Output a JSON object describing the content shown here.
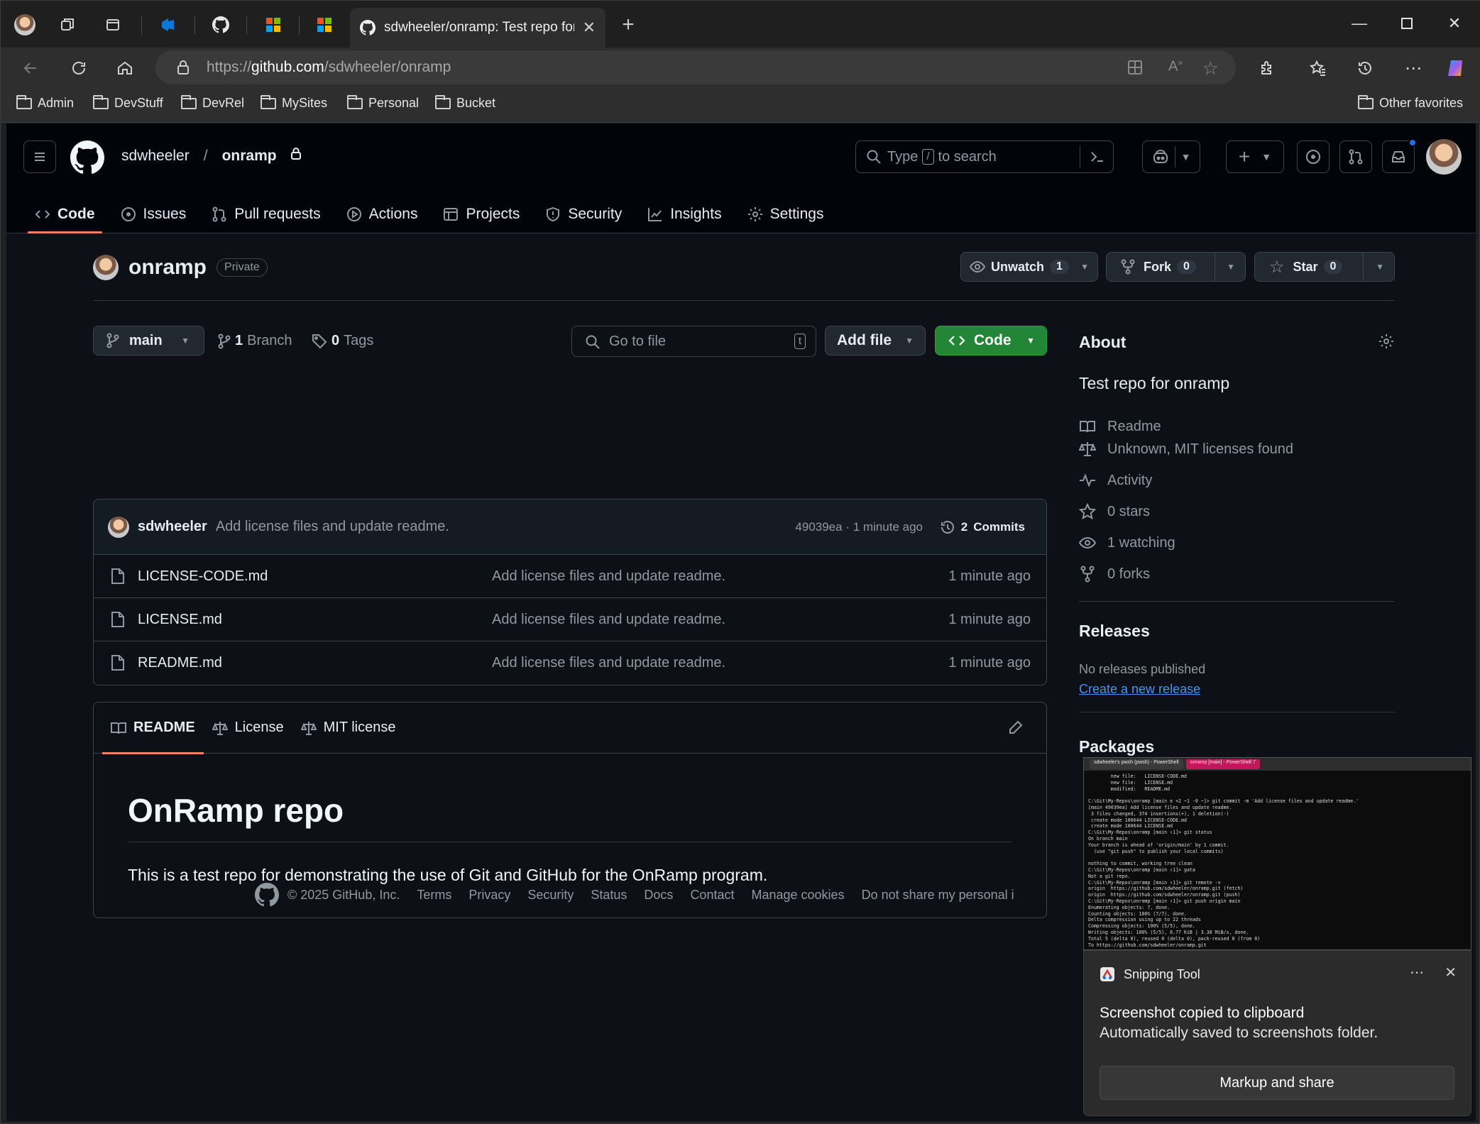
{
  "browser": {
    "active_tab_title": "sdwheeler/onramp: Test repo for onramp",
    "url_scheme": "https://",
    "url_host": "github.com",
    "url_path": "/sdwheeler/onramp",
    "favorites": [
      "Admin",
      "DevStuff",
      "DevRel",
      "MySites",
      "Personal",
      "Bucket"
    ],
    "other_favorites": "Other favorites"
  },
  "header": {
    "owner": "sdwheeler",
    "separator": "/",
    "repo": "onramp",
    "search_prefix": "Type",
    "search_key": "/",
    "search_suffix": "to search"
  },
  "repo_nav": [
    "Code",
    "Issues",
    "Pull requests",
    "Actions",
    "Projects",
    "Security",
    "Insights",
    "Settings"
  ],
  "repo": {
    "name": "onramp",
    "visibility": "Private",
    "unwatch_label": "Unwatch",
    "watch_count": "1",
    "fork_label": "Fork",
    "fork_count": "0",
    "star_label": "Star",
    "star_count": "0"
  },
  "toolbar": {
    "branch": "main",
    "branches_count": "1",
    "branches_label": "Branch",
    "tags_count": "0",
    "tags_label": "Tags",
    "goto_placeholder": "Go to file",
    "goto_key": "t",
    "add_file": "Add file",
    "code": "Code"
  },
  "latest_commit": {
    "author": "sdwheeler",
    "message": "Add license files and update readme.",
    "sha_time": "49039ea · 1 minute ago",
    "commits_count": "2",
    "commits_label": "Commits"
  },
  "files": [
    {
      "name": "LICENSE-CODE.md",
      "message": "Add license files and update readme.",
      "date": "1 minute ago"
    },
    {
      "name": "LICENSE.md",
      "message": "Add license files and update readme.",
      "date": "1 minute ago"
    },
    {
      "name": "README.md",
      "message": "Add license files and update readme.",
      "date": "1 minute ago"
    }
  ],
  "readme": {
    "tabs": [
      "README",
      "License",
      "MIT license"
    ],
    "heading": "OnRamp repo",
    "body": "This is a test repo for demonstrating the use of Git and GitHub for the OnRamp program."
  },
  "about": {
    "title": "About",
    "description": "Test repo for onramp",
    "items": [
      "Readme",
      "Unknown, MIT licenses found",
      "Activity",
      "0 stars",
      "1 watching",
      "0 forks"
    ],
    "releases_title": "Releases",
    "no_releases": "No releases published",
    "create_release": "Create a new release",
    "packages_title": "Packages"
  },
  "footer": {
    "copyright": "© 2025 GitHub, Inc.",
    "links": [
      "Terms",
      "Privacy",
      "Security",
      "Status",
      "Docs",
      "Contact",
      "Manage cookies",
      "Do not share my personal i"
    ]
  },
  "terminal": {
    "tab1": "sdwheeler's pwsh (pwsh) - PowerShell",
    "tab2": "onramp [main] - PowerShell 7",
    "lines": [
      "        new file:   LICENSE-CODE.md",
      "        new file:   LICENSE.md",
      "        modified:   README.md",
      "",
      "C:\\Git\\My-Repos\\onramp [main ≡ +2 ~1 -0 ~]> git commit -m 'Add license files and update readme.'",
      "[main 49039ea] Add license files and update readme.",
      " 3 files changed, 374 insertions(+), 1 deletion(-)",
      " create mode 100644 LICENSE-CODE.md",
      " create mode 100644 LICENSE.md",
      "C:\\Git\\My-Repos\\onramp [main ↑1]> git status",
      "On branch main",
      "Your branch is ahead of 'origin/main' by 1 commit.",
      "  (use \"git push\" to publish your local commits)",
      "",
      "nothing to commit, working tree clean",
      "C:\\Git\\My-Repos\\onramp [main ↑1]> gata",
      "Not a git repo.",
      "C:\\Git\\My-Repos\\onramp [main ↑1]> git remote -v",
      "origin  https://github.com/sdwheeler/onramp.git (fetch)",
      "origin  https://github.com/sdwheeler/onramp.git (push)",
      "C:\\Git\\My-Repos\\onramp [main ↑1]> git push origin main",
      "Enumerating objects: 7, done.",
      "Counting objects: 100% (7/7), done.",
      "Delta compression using up to 22 threads",
      "Compressing objects: 100% (5/5), done.",
      "Writing objects: 100% (5/5), 6.77 KiB | 3.38 MiB/s, done.",
      "Total 5 (delta 0), reused 0 (delta 0), pack-reused 0 (from 0)",
      "To https://github.com/sdwheeler/onramp.git"
    ]
  },
  "toast": {
    "app": "Snipping Tool",
    "title": "Screenshot copied to clipboard",
    "subtitle": "Automatically saved to screenshots folder.",
    "action": "Markup and share"
  },
  "colors": {
    "accent_green": "#238636",
    "tab_underline": "#f78166",
    "link": "#4493f8",
    "notification_dot": "#1f6feb"
  }
}
